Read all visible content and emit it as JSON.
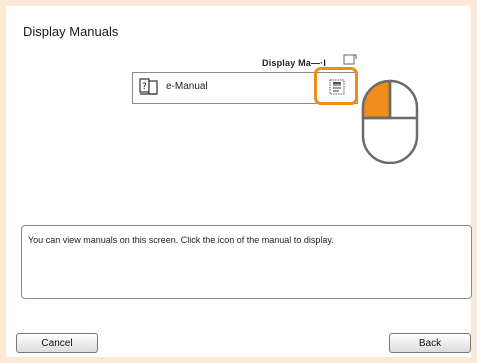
{
  "dialog": {
    "title": "Display Manuals"
  },
  "manuals": {
    "column_header": "Display Ma—·l",
    "items": [
      {
        "label": "e-Manual",
        "icon": "question-book-icon",
        "action_icon": "open-manual-icon"
      }
    ]
  },
  "message": {
    "text": "You can view manuals on this screen. Click the icon of the manual to display."
  },
  "footer": {
    "cancel_label": "Cancel",
    "back_label": "Back"
  },
  "colors": {
    "background": "#fde9d6",
    "highlight": "#f08c1a",
    "mouse_left_button": "#f08c1a"
  }
}
